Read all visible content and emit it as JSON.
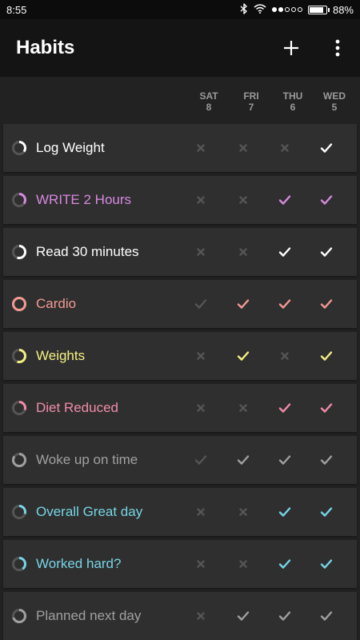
{
  "status": {
    "time": "8:55",
    "battery": "88%",
    "battery_level": 0.88
  },
  "appbar": {
    "title": "Habits"
  },
  "days": [
    {
      "name": "SAT",
      "num": "8"
    },
    {
      "name": "FRI",
      "num": "7"
    },
    {
      "name": "THU",
      "num": "6"
    },
    {
      "name": "WED",
      "num": "5"
    }
  ],
  "colors": {
    "inactive": "#555555"
  },
  "habits": [
    {
      "name": "Log Weight",
      "color": "#ffffff",
      "progress": 0.35,
      "marks": [
        "x",
        "x",
        "x",
        "check"
      ]
    },
    {
      "name": "WRITE 2 Hours",
      "color": "#d68ae0",
      "progress": 0.35,
      "marks": [
        "x",
        "x",
        "check",
        "check"
      ]
    },
    {
      "name": "Read 30 minutes",
      "color": "#ffffff",
      "progress": 0.55,
      "marks": [
        "x",
        "x",
        "check",
        "check"
      ]
    },
    {
      "name": "Cardio",
      "color": "#f29a92",
      "progress": 1.0,
      "marks": [
        "check-dim",
        "check",
        "check",
        "check"
      ]
    },
    {
      "name": "Weights",
      "color": "#f5f082",
      "progress": 0.55,
      "marks": [
        "x",
        "check",
        "x",
        "check"
      ]
    },
    {
      "name": "Diet Reduced",
      "color": "#f08ca9",
      "progress": 0.3,
      "marks": [
        "x",
        "x",
        "check",
        "check"
      ]
    },
    {
      "name": "Woke up on time",
      "color": "#a0a0a0",
      "progress": 0.85,
      "marks": [
        "check-dim",
        "check",
        "check",
        "check"
      ]
    },
    {
      "name": "Overall Great day",
      "color": "#77d5e6",
      "progress": 0.3,
      "marks": [
        "x",
        "x",
        "check",
        "check"
      ]
    },
    {
      "name": "Worked hard?",
      "color": "#77d5e6",
      "progress": 0.4,
      "marks": [
        "x",
        "x",
        "check",
        "check"
      ]
    },
    {
      "name": "Planned next day",
      "color": "#a0a0a0",
      "progress": 0.7,
      "marks": [
        "x",
        "check",
        "check",
        "check"
      ]
    }
  ]
}
